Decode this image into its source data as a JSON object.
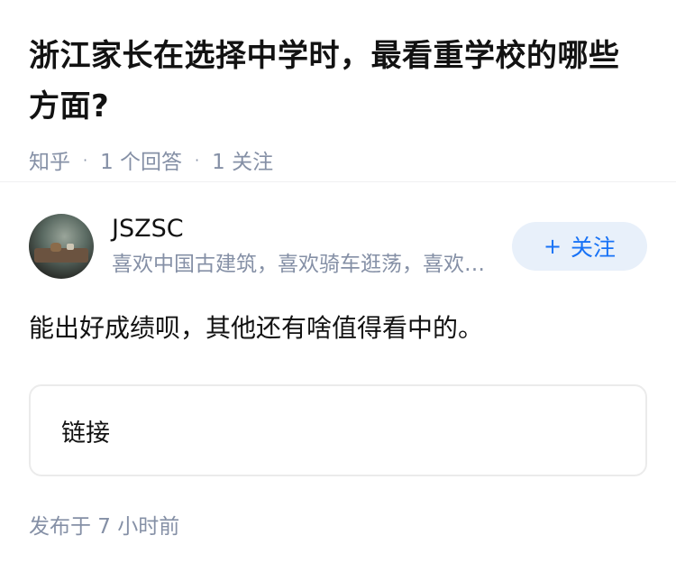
{
  "question": {
    "title": "浙江家长在选择中学时，最看重学校的哪些方面?",
    "source": "知乎",
    "separator": "·",
    "answer_count": "1 个回答",
    "follower_count": "1 关注"
  },
  "answer": {
    "author": {
      "name": "JSZSC",
      "bio": "喜欢中国古建筑，喜欢骑车逛荡，喜欢传统文化"
    },
    "follow_button": {
      "icon": "plus-icon",
      "plus": "+",
      "label": "关注"
    },
    "content": "能出好成绩呗，其他还有啥值得看中的。",
    "link_card_label": "链接",
    "published": "发布于 7 小时前"
  }
}
